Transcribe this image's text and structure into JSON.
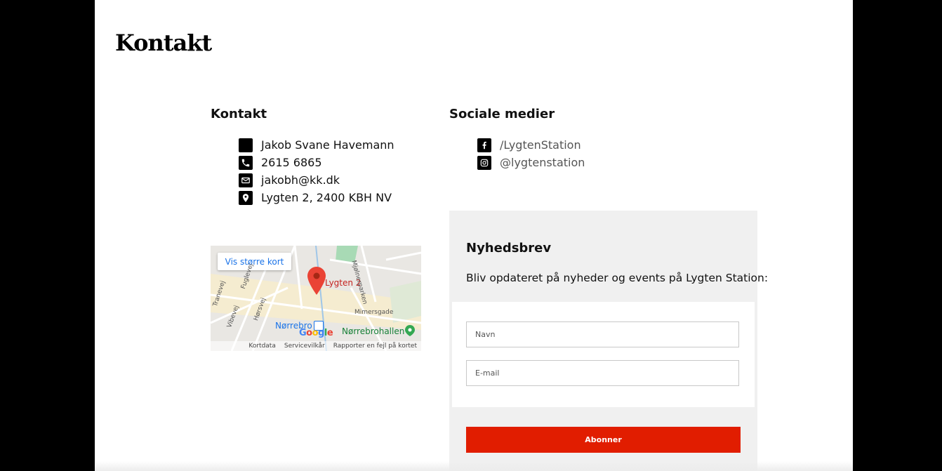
{
  "page": {
    "title": "Kontakt"
  },
  "contact": {
    "heading": "Kontakt",
    "items": [
      {
        "icon": "person-square-icon",
        "text": "Jakob Svane Havemann"
      },
      {
        "icon": "phone-icon",
        "text": "2615 6865"
      },
      {
        "icon": "mail-icon",
        "text": "jakobh@kk.dk"
      },
      {
        "icon": "location-pin-icon",
        "text": "Lygten 2, 2400 KBH NV"
      }
    ]
  },
  "social": {
    "heading": "Sociale medier",
    "items": [
      {
        "icon": "facebook-icon",
        "text": "/LygtenStation"
      },
      {
        "icon": "instagram-icon",
        "text": "@lygtenstation"
      }
    ]
  },
  "map": {
    "larger_map_label": "Vis større kort",
    "pin_label": "Lygten 2",
    "station_label": "Nørrebro",
    "hall_label": "Nørrebrohallen",
    "street_labels": [
      "Mimersgade",
      "Mjølnerparken",
      "Hørsvej",
      "Vibevej",
      "Tranevej",
      "Fuglevej"
    ],
    "footer": [
      "Kortdata",
      "Servicevilkår",
      "Rapporter en fejl på kortet"
    ],
    "logo": "Google"
  },
  "newsletter": {
    "title": "Nyhedsbrev",
    "description": "Bliv opdateret på nyheder og events på Lygten Station:",
    "name_placeholder": "Navn",
    "email_placeholder": "E-mail",
    "subscribe_label": "Abonner"
  },
  "colors": {
    "background_side": "#000000",
    "panel": "#f0f0f0",
    "button": "#e11d00"
  }
}
